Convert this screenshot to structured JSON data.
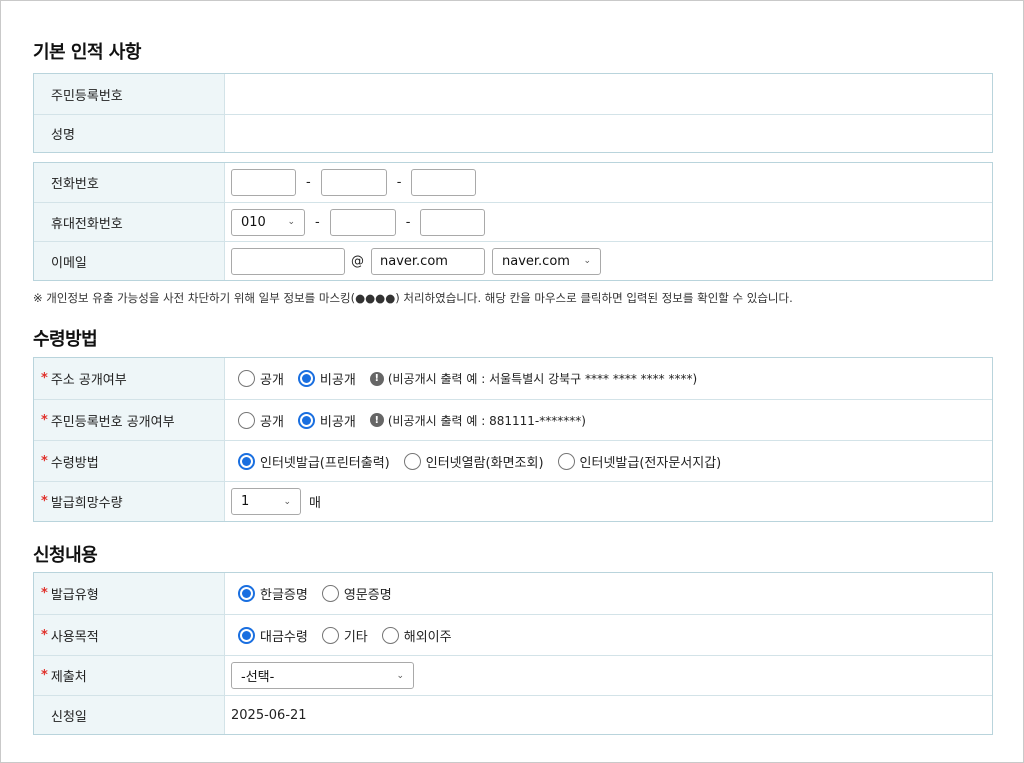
{
  "sections": {
    "basic_title": "기본 인적 사항",
    "receive_title": "수령방법",
    "apply_title": "신청내용"
  },
  "basic": {
    "rrn_label": "주민등록번호",
    "name_label": "성명"
  },
  "contact": {
    "phone_label": "전화번호",
    "mobile_label": "휴대전화번호",
    "mobile_prefix": "010",
    "email_label": "이메일",
    "at_sign": "@",
    "email_domain_value": "naver.com",
    "email_domain_select": "naver.com",
    "dash": "-"
  },
  "notice": "※ 개인정보 유출 가능성을 사전 차단하기 위해 일부 정보를 마스킹(●●●●) 처리하였습니다. 해당 칸을 마우스로 클릭하면 입력된 정보를 확인할 수 있습니다.",
  "receive": {
    "address_label": "주소 공개여부",
    "rrn_public_label": "주민등록번호 공개여부",
    "method_label": "수령방법",
    "qty_label": "발급희망수량",
    "public": "공개",
    "private": "비공개",
    "address_hint": "(비공개시 출력 예 : 서울특별시 강북구 **** **** **** ****)",
    "rrn_hint": "(비공개시 출력 예 : 881111-*******)",
    "method_opt1": "인터넷발급(프린터출력)",
    "method_opt2": "인터넷열람(화면조회)",
    "method_opt3": "인터넷발급(전자문서지갑)",
    "qty_value": "1",
    "qty_unit": "매"
  },
  "apply": {
    "type_label": "발급유형",
    "type_opt1": "한글증명",
    "type_opt2": "영문증명",
    "purpose_label": "사용목적",
    "purpose_opt1": "대금수령",
    "purpose_opt2": "기타",
    "purpose_opt3": "해외이주",
    "submit_label": "제출처",
    "submit_select": "-선택-",
    "date_label": "신청일",
    "date_value": "2025-06-21"
  },
  "required_mark": "*",
  "colors": {
    "label_bg": "#eef6f8",
    "border": "#b9d4dc",
    "radio_accent": "#1a6fe0",
    "required": "#e0312b"
  }
}
